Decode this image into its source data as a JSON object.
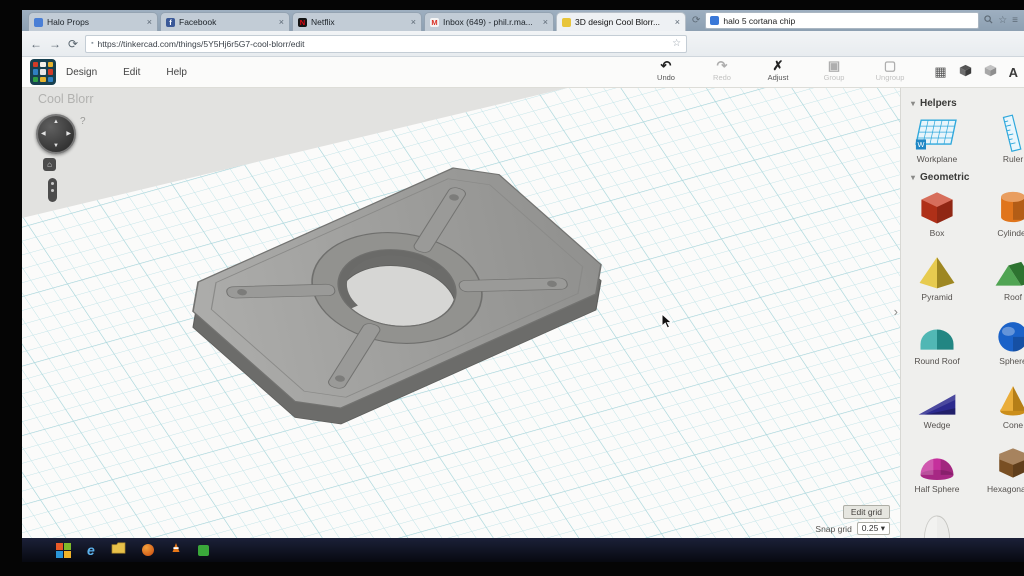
{
  "icons": {
    "close": "×",
    "back": "←",
    "forward": "→",
    "refresh": "⟳",
    "star": "☆",
    "menu": "≡",
    "chevron": "›",
    "dropdown": "▾",
    "section_arrow": "▾",
    "help": "?",
    "home": "⌂",
    "grid_view": "▦",
    "address_badge": "▪",
    "nav_up": "▲",
    "nav_down": "▼",
    "nav_left": "◀",
    "nav_right": "▶"
  },
  "window": {
    "tabs": [
      {
        "title": "Halo Props",
        "fav_bg": "#4a7fd6",
        "fav_fg": "#ffffff",
        "fav_text": ""
      },
      {
        "title": "Facebook",
        "fav_bg": "#3b5998",
        "fav_fg": "#ffffff",
        "fav_text": "f"
      },
      {
        "title": "Netflix",
        "fav_bg": "#141414",
        "fav_fg": "#e50914",
        "fav_text": "N"
      },
      {
        "title": "Inbox (649) - phil.r.ma...",
        "fav_bg": "#f4f4f4",
        "fav_fg": "#d93025",
        "fav_text": "M"
      },
      {
        "title": "3D design Cool Blorr...",
        "fav_bg": "#e8c53a",
        "fav_fg": "#7a5c10",
        "fav_text": ""
      }
    ],
    "search_text": "halo 5 cortana chip",
    "address": "https://tinkercad.com/things/5Y5Hj6r5G7-cool-blorr/edit"
  },
  "app": {
    "menus": [
      {
        "label": "Design"
      },
      {
        "label": "Edit"
      },
      {
        "label": "Help"
      }
    ],
    "tools": [
      {
        "label": "Undo",
        "icon": "↶"
      },
      {
        "label": "Redo",
        "icon": "↷"
      },
      {
        "label": "Adjust",
        "icon": "✗"
      },
      {
        "label": "Group",
        "icon": "▣"
      },
      {
        "label": "Ungroup",
        "icon": "▢"
      }
    ],
    "design_title": "Cool Blorr",
    "account_initial": "A",
    "logo_colors": [
      "#d23b28",
      "#f5f0e8",
      "#e6b32e",
      "#2f7fc2",
      "#e8e8e8",
      "#d23b28",
      "#2f9e44",
      "#e6b32e",
      "#2f7fc2"
    ],
    "grid_controls": {
      "edit_button": "Edit grid",
      "snap_label": "Snap grid",
      "snap_value": "0.25"
    }
  },
  "sidebar": {
    "helpers": {
      "title": "Helpers",
      "workplane_badge": "W",
      "items": [
        {
          "label": "Workplane"
        },
        {
          "label": "Ruler"
        }
      ]
    },
    "geometric": {
      "title": "Geometric",
      "items": [
        {
          "label": "Box",
          "color": "#c8371c"
        },
        {
          "label": "Cylinder",
          "color": "#e0751c"
        },
        {
          "label": "Pyramid",
          "color": "#e3c231"
        },
        {
          "label": "Roof",
          "color": "#3d9a40"
        },
        {
          "label": "Round Roof",
          "color": "#2ba8a4"
        },
        {
          "label": "Sphere",
          "color": "#1b62c8"
        },
        {
          "label": "Wedge",
          "color": "#2c2a8e"
        },
        {
          "label": "Cone",
          "color": "#e8a21e"
        },
        {
          "label": "Half Sphere",
          "color": "#c5309c"
        },
        {
          "label": "Hexagonal Prism",
          "color": "#8a5a28"
        },
        {
          "label": "",
          "color": "#ececea"
        }
      ]
    }
  },
  "taskbar": {
    "ie_letter": "e"
  }
}
